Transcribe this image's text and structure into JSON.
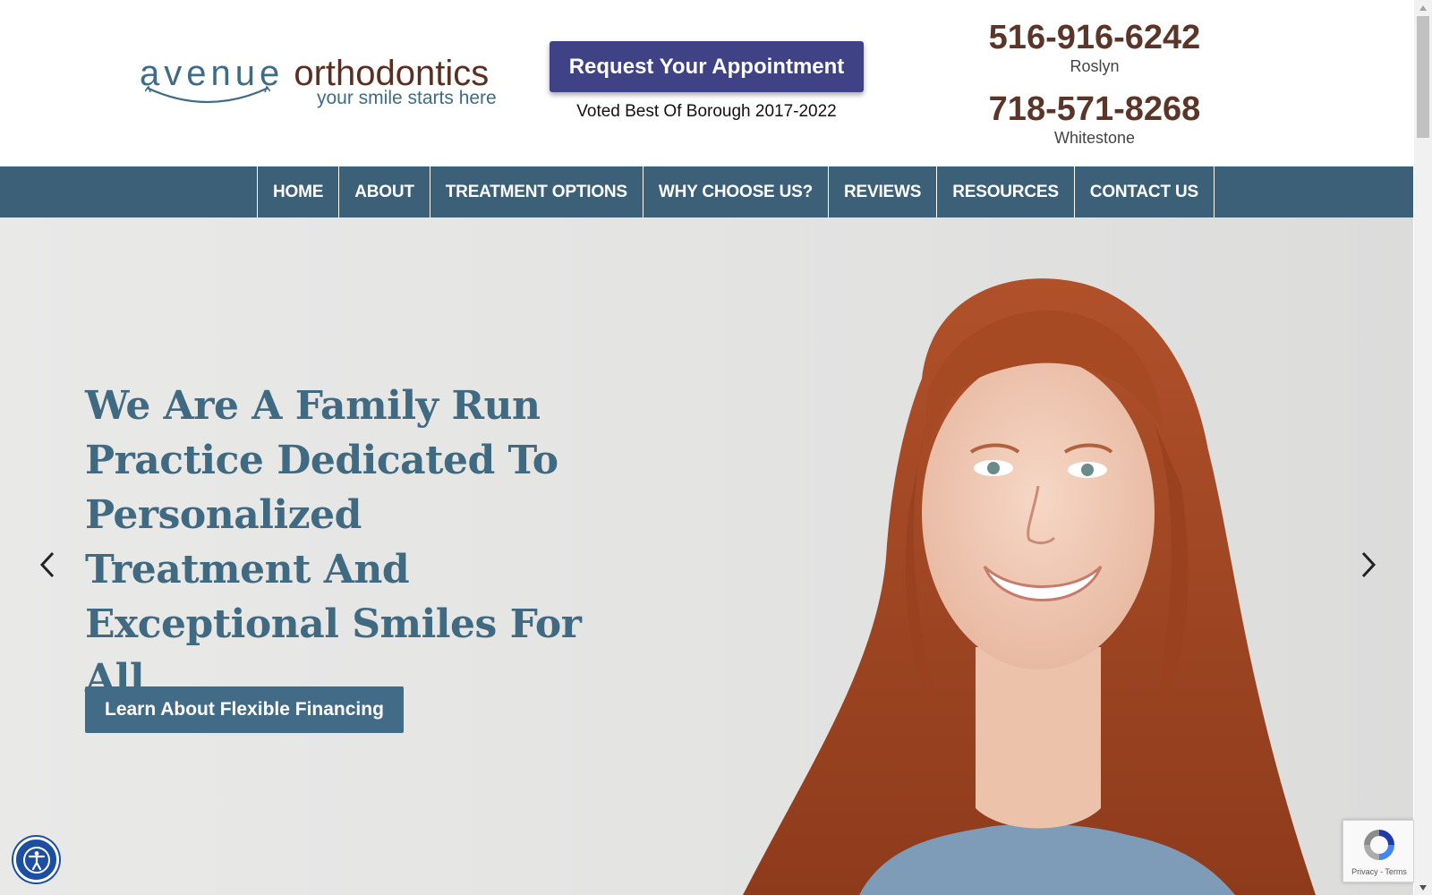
{
  "header": {
    "logo": {
      "word1": "avenue",
      "word2": "orthodontics",
      "tagline": "your smile starts here"
    },
    "appointment_button": "Request Your Appointment",
    "voted_text": "Voted Best Of Borough 2017-2022",
    "phones": [
      {
        "number": "516-916-6242",
        "location": "Roslyn"
      },
      {
        "number": "718-571-8268",
        "location": "Whitestone"
      }
    ]
  },
  "nav": {
    "items": [
      {
        "label": "HOME"
      },
      {
        "label": "ABOUT"
      },
      {
        "label": "TREATMENT OPTIONS"
      },
      {
        "label": "WHY CHOOSE US?"
      },
      {
        "label": "REVIEWS"
      },
      {
        "label": "RESOURCES"
      },
      {
        "label": "CONTACT US"
      }
    ]
  },
  "hero": {
    "headline": "We Are A Family Run Practice Dedicated To Personalized Treatment And Exceptional Smiles For All",
    "cta": "Learn About Flexible Financing",
    "prev_icon": "chevron-left-icon",
    "next_icon": "chevron-right-icon"
  },
  "widgets": {
    "accessibility_icon": "accessibility-icon",
    "recaptcha_text": "Privacy - Terms"
  },
  "colors": {
    "nav_bg": "#3b6077",
    "appointment_bg": "#3f4385",
    "phone": "#5a3528",
    "headline": "#3f6a82",
    "cta_bg": "#426b87",
    "accessibility_bg": "#1c4ea1"
  }
}
